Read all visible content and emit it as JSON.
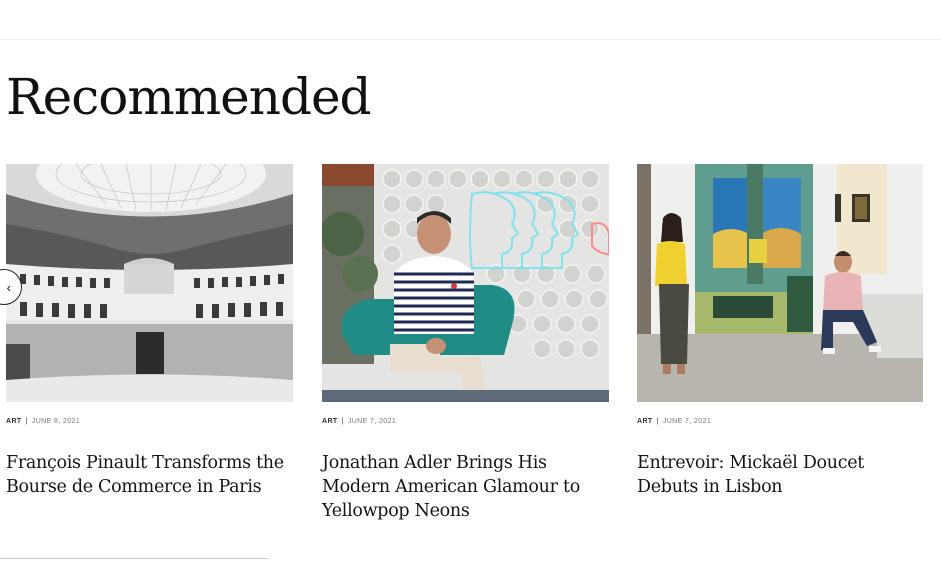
{
  "section": {
    "title": "Recommended"
  },
  "carousel": {
    "prev_glyph": "‹"
  },
  "cards": [
    {
      "category": "ART",
      "separator": "|",
      "date": "JUNE 8, 2021",
      "title": "François Pinault Transforms the Bourse de Commerce in Paris",
      "image_alt": "Bourse de Commerce rotunda interior"
    },
    {
      "category": "ART",
      "separator": "|",
      "date": "JUNE 7, 2021",
      "title": "Jonathan Adler Brings His Modern American Glamour to Yellowpop Neons",
      "image_alt": "Man seated in teal chair before neon wall"
    },
    {
      "category": "ART",
      "separator": "|",
      "date": "JUNE 7, 2021",
      "title": "Entrevoir: Mickaël Doucet Debuts in Lisbon",
      "image_alt": "Two people in a gallery with a large painting"
    }
  ],
  "colors": {
    "text": "#151515",
    "meta": "#777777",
    "teal_chair": "#1f8c86",
    "neon": "#7fe3f0"
  }
}
